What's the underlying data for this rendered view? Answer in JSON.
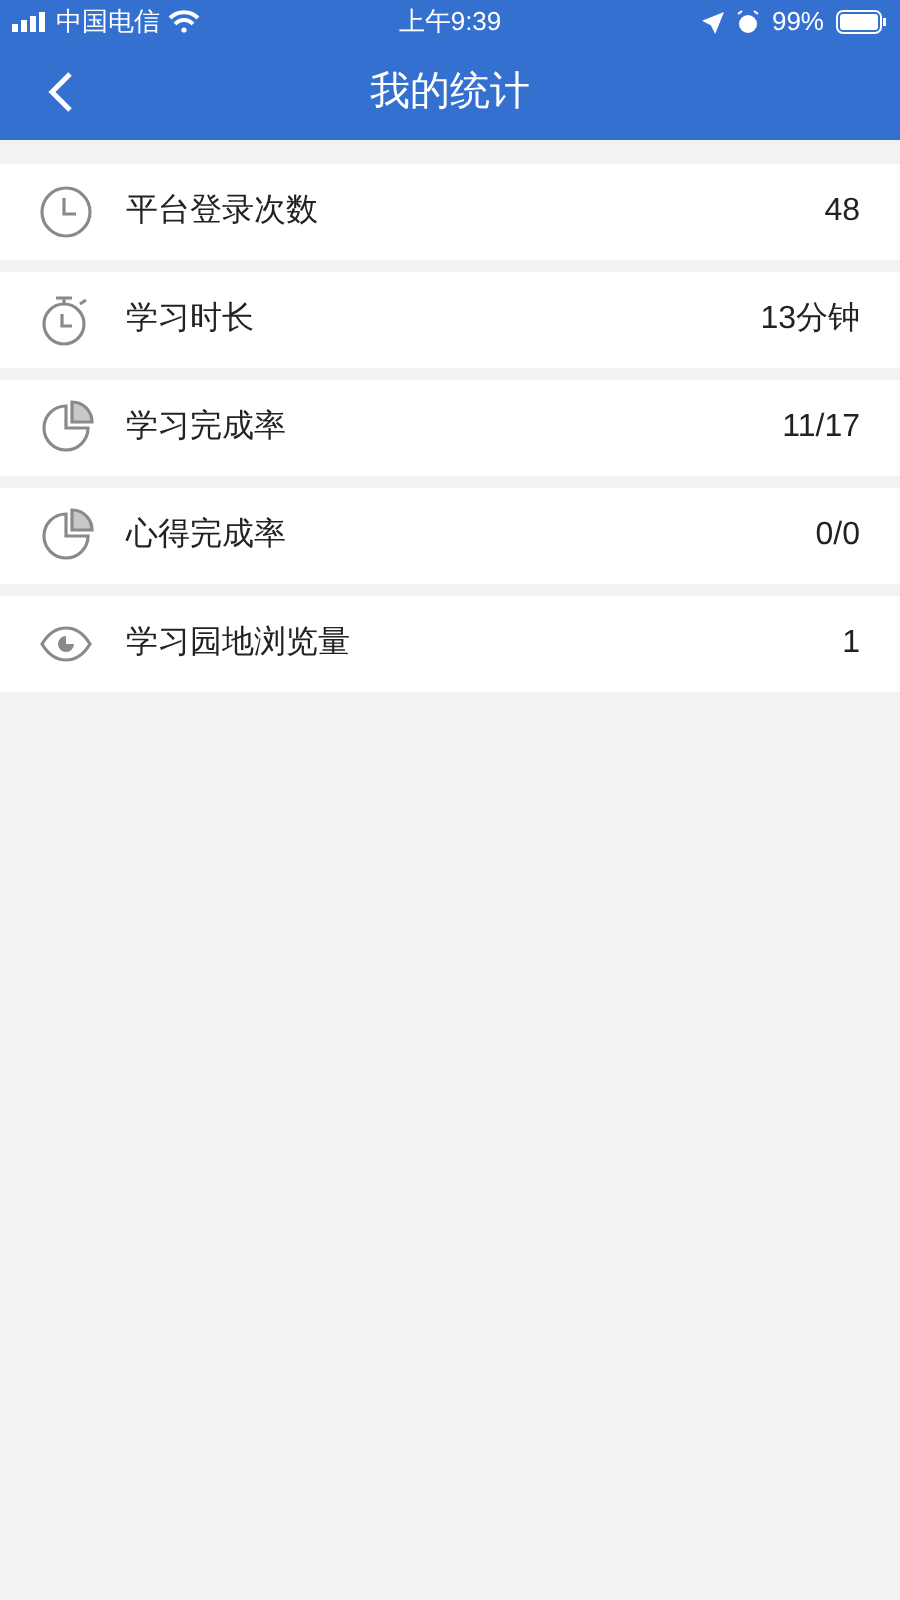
{
  "status_bar": {
    "carrier": "中国电信",
    "time": "上午9:39",
    "battery": "99%"
  },
  "nav": {
    "title": "我的统计"
  },
  "stats": [
    {
      "kind": "clock",
      "label": "平台登录次数",
      "value": "48"
    },
    {
      "kind": "stopwatch",
      "label": "学习时长",
      "value": "13分钟"
    },
    {
      "kind": "pie",
      "label": "学习完成率",
      "value": "11/17"
    },
    {
      "kind": "pie",
      "label": "心得完成率",
      "value": "0/0"
    },
    {
      "kind": "eye",
      "label": "学习园地浏览量",
      "value": "1"
    }
  ]
}
